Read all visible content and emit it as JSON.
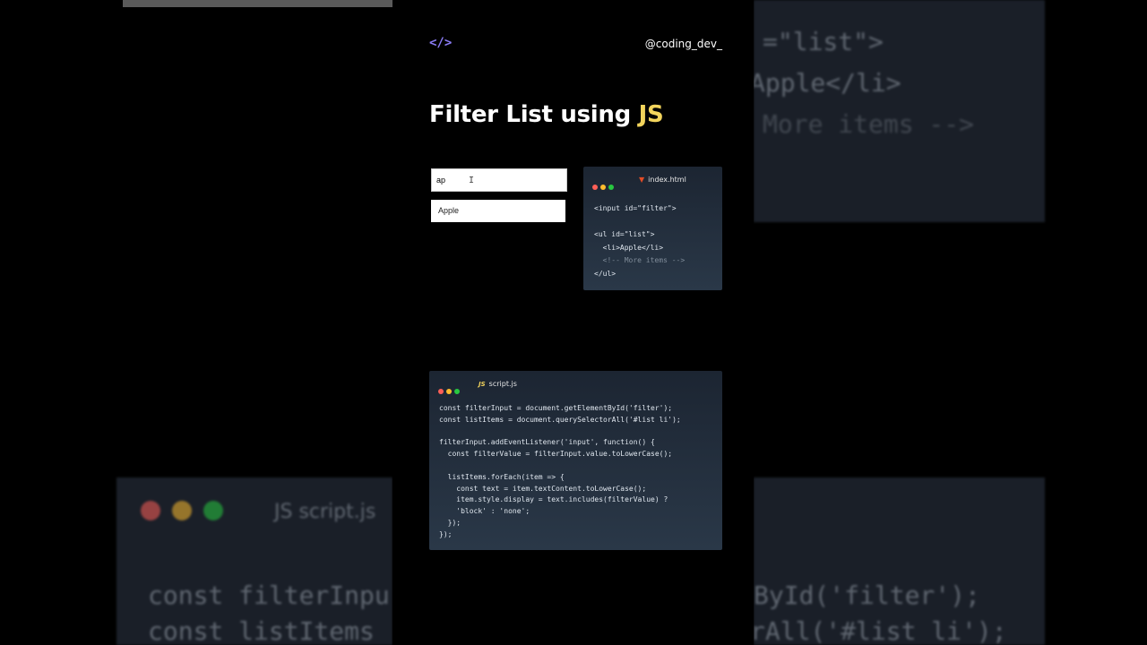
{
  "brand": {
    "logo": "</>",
    "handle": "@coding_dev_"
  },
  "title": {
    "main": "Filter List using ",
    "accent": "JS"
  },
  "demo": {
    "input_value": "ap",
    "list_items": [
      "Apple"
    ]
  },
  "html_window": {
    "filename": "index.html",
    "icon": "html5-icon",
    "lines": [
      "<input id=\"filter\">",
      "",
      "<ul id=\"list\">",
      "  <li>Apple</li>",
      "  <!-- More items -->",
      "</ul>"
    ]
  },
  "js_window": {
    "filename": "script.js",
    "icon": "js-icon",
    "icon_label": "JS",
    "lines": [
      "const filterInput = document.getElementById('filter');",
      "const listItems = document.querySelectorAll('#list li');",
      "",
      "filterInput.addEventListener('input', function() {",
      "  const filterValue = filterInput.value.toLowerCase();",
      "",
      "  listItems.forEach(item => {",
      "    const text = item.textContent.toLowerCase();",
      "    item.style.display = text.includes(filterValue) ?",
      "    'block' : 'none';",
      "  });",
      "});"
    ]
  },
  "background": {
    "right_top_lines": [
      "=\"list\">",
      "Apple</li>",
      "More items -->"
    ],
    "left_bottom_title": "JS script.js",
    "left_bottom_lines": [
      "const filterInpu",
      "const listItems"
    ],
    "right_bottom_lines": [
      "ById('filter');",
      "rAll('#list li');"
    ]
  },
  "colors": {
    "accent": "#f2d45c",
    "logo": "#8b7cf6",
    "code_bg": "#1c2532"
  }
}
